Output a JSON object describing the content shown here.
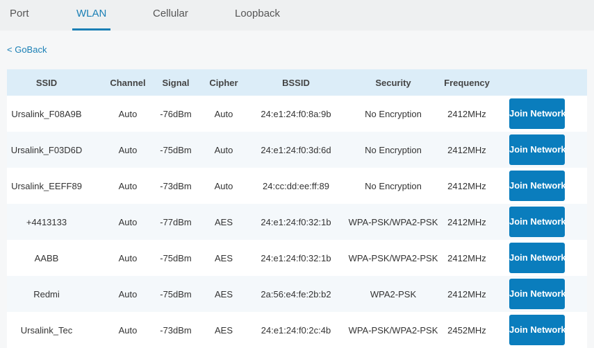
{
  "tabs": [
    {
      "label": "Port"
    },
    {
      "label": "WLAN"
    },
    {
      "label": "Cellular"
    },
    {
      "label": "Loopback"
    }
  ],
  "goback": "< GoBack",
  "columns": [
    "SSID",
    "Channel",
    "Signal",
    "Cipher",
    "BSSID",
    "Security",
    "Frequency"
  ],
  "join_label": "Join Network",
  "rows": [
    [
      "Ursalink_F08A9B",
      "Auto",
      "-76dBm",
      "Auto",
      "24:e1:24:f0:8a:9b",
      "No Encryption",
      "2412MHz"
    ],
    [
      "Ursalink_F03D6D",
      "Auto",
      "-75dBm",
      "Auto",
      "24:e1:24:f0:3d:6d",
      "No Encryption",
      "2412MHz"
    ],
    [
      "Ursalink_EEFF89",
      "Auto",
      "-73dBm",
      "Auto",
      "24:cc:dd:ee:ff:89",
      "No Encryption",
      "2412MHz"
    ],
    [
      "+4413133",
      "Auto",
      "-77dBm",
      "AES",
      "24:e1:24:f0:32:1b",
      "WPA-PSK/WPA2-PSK",
      "2412MHz"
    ],
    [
      "AABB",
      "Auto",
      "-75dBm",
      "AES",
      "24:e1:24:f0:32:1b",
      "WPA-PSK/WPA2-PSK",
      "2412MHz"
    ],
    [
      "Redmi",
      "Auto",
      "-75dBm",
      "AES",
      "2a:56:e4:fe:2b:b2",
      "WPA2-PSK",
      "2412MHz"
    ],
    [
      "Ursalink_Tec",
      "Auto",
      "-73dBm",
      "AES",
      "24:e1:24:f0:2c:4b",
      "WPA-PSK/WPA2-PSK",
      "2452MHz"
    ]
  ]
}
